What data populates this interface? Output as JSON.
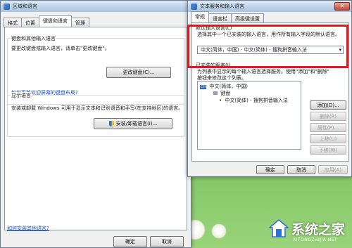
{
  "left_window": {
    "title": "区域和语言",
    "tabs": [
      "格式",
      "位置",
      "键盘和语言",
      "管理"
    ],
    "active_tab": "键盘和语言",
    "keyboard_group": {
      "label": "键盘和其他输入语言",
      "description": "要更改键盘或输入语言，请单击\"更改键盘\"。",
      "change_button": "更改键盘(C)...",
      "help_link": "如何更改欢迎屏幕的键盘布局?"
    },
    "display_group": {
      "label": "显示语言",
      "description": "安装或卸载 Windows 可用于显示文本和识别语音和手写(在支持地区)的语言。",
      "install_button": "安装/卸载语言(I)..."
    },
    "install_link": "如何安装其他语言?",
    "footer_buttons": {
      "ok": "确定",
      "cancel": "取消"
    }
  },
  "right_window": {
    "title": "文本服务和输入语言",
    "tabs": [
      "常规",
      "语言栏",
      "高级键设置"
    ],
    "active_tab": "常规",
    "default_input": {
      "label": "默认输入语言(L)",
      "description": "选择其中一个已安装的输入语言，用作所有输入字段的默认语言。",
      "selected": "中文(简体，中国) - 中文(简体) - 搜狗拼音输入法"
    },
    "installed_services": {
      "label": "已安装的服务(I)",
      "description_1": "为列表中显示的每个输入语言选择服务。使用\"添加\"和\"删除\"",
      "description_2": "按钮来修改这个列表。",
      "tree": {
        "language": "中文(简体，中国)",
        "category": "键盘",
        "service": "中文(简体) - 搜狗拼音输入法"
      },
      "buttons": {
        "add": "添加(D)...",
        "remove": "删除(R)",
        "properties": "属性(P)...",
        "move_up": "上移(U)",
        "move_down": "下移(W)"
      }
    },
    "footer_buttons": {
      "ok": "确定",
      "cancel": "取消",
      "apply": "应用(A)"
    }
  },
  "watermark": {
    "text": "系统之家",
    "url": "XITONGZHIJIA.NET"
  },
  "colors": {
    "highlight": "#e01a1a",
    "link": "#1a56c4",
    "desktop": "#6fbb57"
  }
}
